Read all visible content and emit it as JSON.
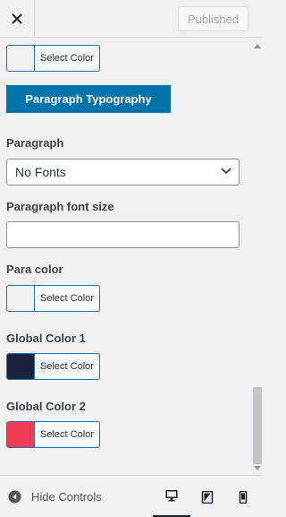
{
  "header": {
    "close_icon": "close-icon",
    "publish_label": "Published"
  },
  "controls": {
    "top_color": {
      "label": "Select Color",
      "swatch": "#f0f0f1"
    },
    "section_label": "Paragraph Typography",
    "paragraph": {
      "label": "Paragraph",
      "selected": "No Fonts"
    },
    "font_size": {
      "label": "Paragraph font size",
      "value": ""
    },
    "para_color": {
      "label": "Para color",
      "picker_label": "Select Color",
      "swatch": "#f0f0f1"
    },
    "global_color_1": {
      "label": "Global Color 1",
      "picker_label": "Select Color",
      "swatch": "#1b2240"
    },
    "global_color_2": {
      "label": "Global Color 2",
      "picker_label": "Select Color",
      "swatch": "#ef3852"
    }
  },
  "footer": {
    "hide_label": "Hide Controls",
    "devices": [
      "desktop-icon",
      "tablet-icon",
      "mobile-icon"
    ]
  },
  "colors": {
    "accent": "#0073aa",
    "focus_border": "#2271b1"
  }
}
